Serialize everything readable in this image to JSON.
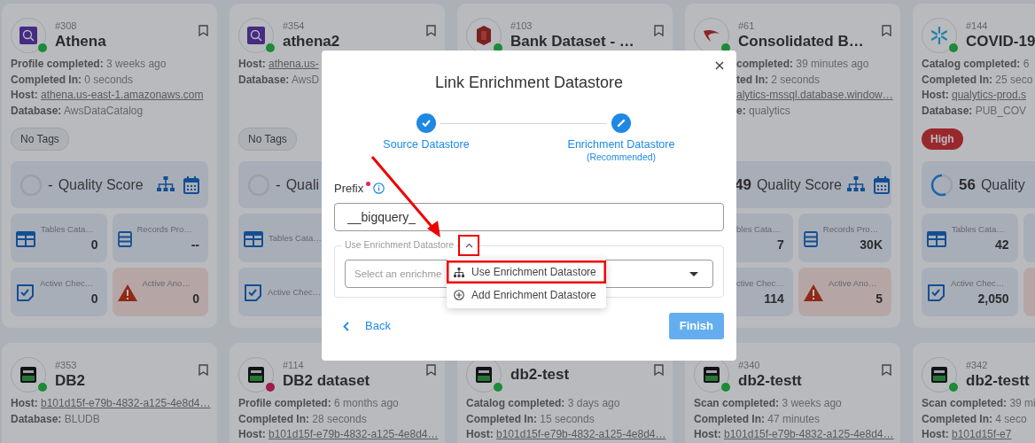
{
  "cards": [
    {
      "kind": "athena",
      "number": "#308",
      "name": "Athena",
      "color": "#1d8a37",
      "lines": [
        {
          "label": "Profile completed:",
          "value": "3 weeks ago"
        },
        {
          "label": "Completed In:",
          "value": "0 seconds"
        },
        {
          "label": "Host:",
          "value": "athena.us-east-1.amazonaws.com",
          "link": true
        },
        {
          "label": "Database:",
          "value": "AwsDataCatalog"
        }
      ],
      "tag": {
        "label": "No Tags",
        "kind": "none"
      },
      "quality": {
        "score": "-",
        "label": "Quality Score"
      },
      "tiles": [
        {
          "kind": "tables",
          "label": "Tables Cata…",
          "value": "0"
        },
        {
          "kind": "records",
          "label": "Records Pro…",
          "value": "--"
        },
        {
          "kind": "checks",
          "label": "Active Chec…",
          "value": "0"
        },
        {
          "kind": "anomalies",
          "label": "Active Ano…",
          "value": "0"
        }
      ]
    },
    {
      "kind": "athena",
      "number": "#354",
      "name": "athena2",
      "color": "#1d8a37",
      "lines": [
        {
          "label": "Host:",
          "value": "athena.us-",
          "link": true
        },
        {
          "label": "Database:",
          "value": "AwsD"
        }
      ],
      "tag": {
        "label": "No Tags",
        "kind": "none"
      },
      "quality": {
        "score": "-",
        "label": "Quali"
      },
      "tiles": [
        {
          "kind": "tables",
          "label": "Tables Cata…"
        },
        {
          "kind": "checks",
          "label": "Active Chec…"
        }
      ]
    },
    {
      "kind": "redshift",
      "number": "#103",
      "name": "Bank Dataset - …",
      "color": "#1d8a37"
    },
    {
      "kind": "mssql",
      "number": "#61",
      "name": "Consolidated B…",
      "color": "#1d8a37",
      "lines": [
        {
          "label": "completed:",
          "value": "39 minutes ago"
        },
        {
          "label": "ted In:",
          "value": "2 seconds"
        },
        {
          "value": "alytics-mssql.database.window…",
          "link": true
        },
        {
          "label": "e:",
          "value": "qualytics"
        }
      ],
      "quality": {
        "score": "49",
        "label": "Quality Score"
      },
      "tiles": [
        {
          "kind": "tables",
          "label": "bles Cata…",
          "value": "7"
        },
        {
          "kind": "records",
          "label": "Records Pro…",
          "value": "30K"
        },
        {
          "kind": "checks",
          "label": "ctive Chec…",
          "value": "114"
        },
        {
          "kind": "anomalies",
          "label": "Active Ano…",
          "value": "5"
        }
      ]
    },
    {
      "kind": "snowflake",
      "number": "#144",
      "name": "COVID-19",
      "color": "#1d8a37",
      "lines": [
        {
          "label": "Catalog completed:",
          "value": "6"
        },
        {
          "label": "Completed In:",
          "value": "25 seco"
        },
        {
          "label": "Host:",
          "value": "qualytics-prod.s",
          "link": true
        },
        {
          "label": "Database:",
          "value": "PUB_COV"
        }
      ],
      "tag": {
        "label": "High",
        "kind": "high"
      },
      "quality": {
        "score": "56",
        "label": "Quality",
        "level": 0.56
      },
      "tiles": [
        {
          "kind": "tables",
          "label": "Tables Cata…",
          "value": "42"
        },
        {
          "kind": "records"
        },
        {
          "kind": "checks",
          "label": "Active Chec…",
          "value": "2,050"
        },
        {
          "kind": "anomalies"
        }
      ]
    },
    {
      "kind": "db2",
      "number": "#353",
      "name": "DB2",
      "color": "#1d8a37",
      "lines": [
        {
          "label": "Host:",
          "value": "b101d15f-e79b-4832-a125-4e8d4…",
          "link": true
        },
        {
          "label": "Database:",
          "value": "BLUDB"
        }
      ]
    },
    {
      "kind": "db2",
      "number": "#114",
      "name": "DB2 dataset",
      "color": "#a01a4f",
      "lines": [
        {
          "label": "Profile completed:",
          "value": "6 months ago"
        },
        {
          "label": "Completed In:",
          "value": "28 seconds"
        },
        {
          "label": "Host:",
          "value": "b101d15f-e79b-4832-a125-4e8d4…",
          "link": true
        }
      ]
    },
    {
      "kind": "db2",
      "name": "db2-test",
      "color": "#1d8a37",
      "lines": [
        {
          "label": "Catalog completed:",
          "value": "3 days ago"
        },
        {
          "label": "Completed In:",
          "value": "15 seconds"
        },
        {
          "label": "Host:",
          "value": "b101d15f-e79b-4832-a125-4e8d4…",
          "link": true
        }
      ]
    },
    {
      "kind": "db2",
      "number": "#340",
      "name": "db2-testt",
      "color": "#1d8a37",
      "lines": [
        {
          "label": "Scan completed:",
          "value": "3 weeks ago"
        },
        {
          "label": "Completed In:",
          "value": "47 minutes"
        },
        {
          "label": "Host:",
          "value": "b101d15f-e79b-4832-a125-4e8d4…",
          "link": true
        }
      ]
    },
    {
      "kind": "db2",
      "number": "#342",
      "name": "db2-testt",
      "color": "#1d8a37",
      "lines": [
        {
          "label": "Scan completed:",
          "value": "39 mi"
        },
        {
          "label": "Completed In:",
          "value": "4 seco"
        },
        {
          "label": "Host:",
          "value": "b101d15f-e7",
          "link": true
        }
      ]
    }
  ],
  "modal": {
    "title": "Link Enrichment Datastore",
    "steps": [
      {
        "label": "Source Datastore",
        "completed": true
      },
      {
        "label": "Enrichment Datastore",
        "note": "(Recommended)",
        "completed": false
      }
    ],
    "prefix": {
      "label": "Prefix",
      "required": true,
      "value": "__bigquery_"
    },
    "enrichment": {
      "legend": "Use Enrichment Datastore",
      "expanded": true,
      "placeholder": "Select an enrichme"
    },
    "menu": [
      {
        "label": "Use Enrichment Datastore",
        "kind": "use"
      },
      {
        "label": "Add Enrichment Datastore",
        "kind": "add"
      }
    ],
    "back": "Back",
    "finish": {
      "label": "Finish",
      "disabled": true
    }
  }
}
